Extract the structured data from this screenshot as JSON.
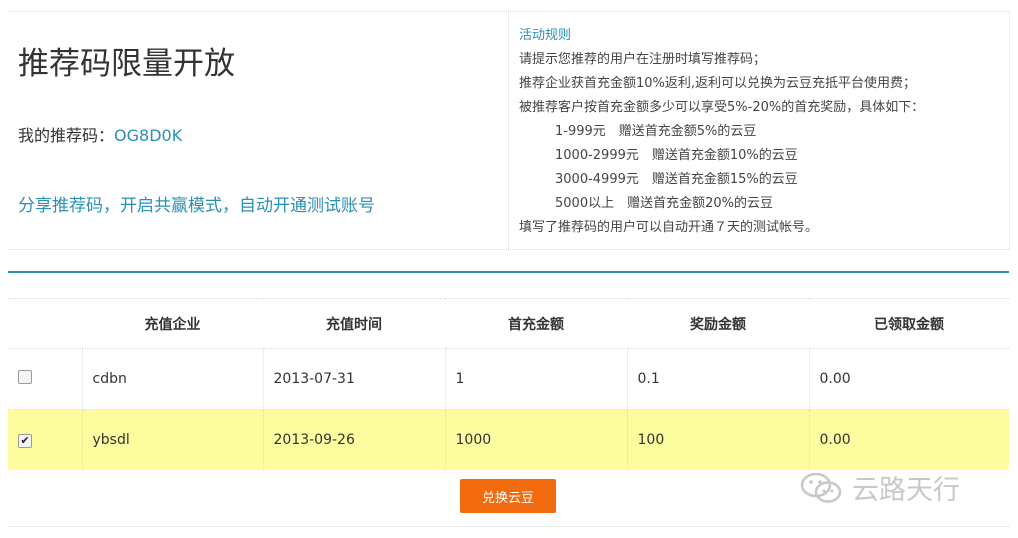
{
  "header": {
    "title": "推荐码限量开放",
    "code_label": "我的推荐码：",
    "code_value": "OG8D0K",
    "share_link": "分享推荐码，开启共赢模式，自动开通测试账号"
  },
  "rules": {
    "title": "活动规则",
    "lines": [
      "请提示您推荐的用户在注册时填写推荐码；",
      "推荐企业获首充金额10%返利,返利可以兑换为云豆充抵平台使用费；",
      "被推荐客户按首充金额多少可以享受5%-20%的首充奖励，具体如下："
    ],
    "tiers": [
      "1-999元　赠送首充金额5%的云豆",
      "1000-2999元　赠送首充金额10%的云豆",
      "3000-4999元　赠送首充金额15%的云豆",
      "5000以上　赠送首充金额20%的云豆"
    ],
    "footer": "填写了推荐码的用户可以自动开通７天的测试帐号。"
  },
  "table": {
    "headers": [
      "充值企业",
      "充值时间",
      "首充金额",
      "奖励金额",
      "已领取金额"
    ],
    "rows": [
      {
        "checked": false,
        "company": "cdbn",
        "date": "2013-07-31",
        "first": "1",
        "reward": "0.1",
        "received": "0.00"
      },
      {
        "checked": true,
        "company": "ybsdl",
        "date": "2013-09-26",
        "first": "1000",
        "reward": "100",
        "received": "0.00"
      }
    ]
  },
  "actions": {
    "redeem_label": "兑换云豆"
  },
  "watermark": {
    "text": "云路天行",
    "icon": "wechat-icon"
  },
  "colors": {
    "accent": "#2a91b4",
    "button": "#f26b0f",
    "highlight_row": "#fdfda0"
  }
}
